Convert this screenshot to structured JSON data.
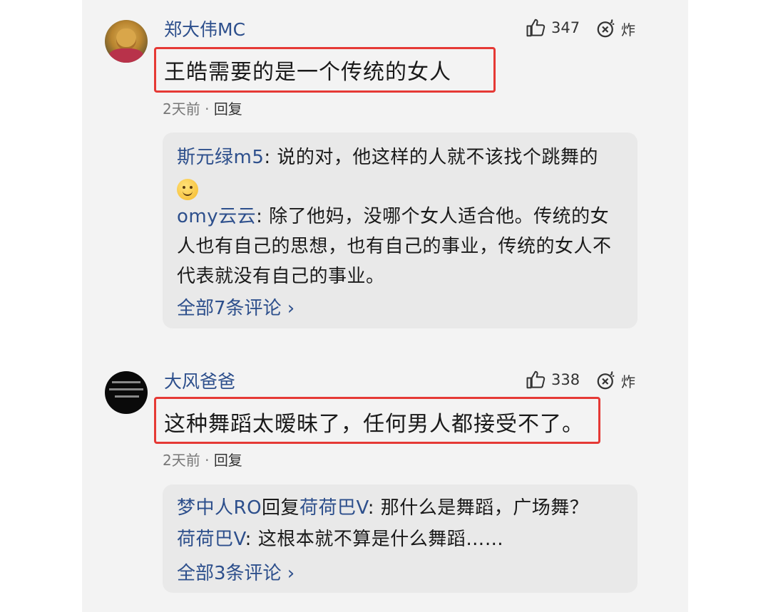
{
  "comments": [
    {
      "username": "郑大伟MC",
      "likes": "347",
      "bomb_label": "炸",
      "text": "王皓需要的是一个传统的女人",
      "time": "2天前",
      "separator": "·",
      "reply_label": "回复",
      "replies": [
        {
          "name": "斯元绿m5",
          "colon": ":",
          "text": " 说的对，他这样的人就不该找个跳舞的",
          "emoji": "smile-emoji"
        },
        {
          "name": "omy云云",
          "colon": ":",
          "text": " 除了他妈，没哪个女人适合他。传统的女人也有自己的思想，也有自己的事业，传统的女人不代表就没有自己的事业。"
        }
      ],
      "view_all": "全部7条评论 ›"
    },
    {
      "username": "大风爸爸",
      "likes": "338",
      "bomb_label": "炸",
      "text": "这种舞蹈太暧昧了，任何男人都接受不了。",
      "time": "2天前",
      "separator": "·",
      "reply_label": "回复",
      "replies": [
        {
          "name": "梦中人RO",
          "mid": "回复",
          "name2": "荷荷巴V",
          "colon": ":",
          "text": " 那什么是舞蹈，广场舞？"
        },
        {
          "name": "荷荷巴V",
          "colon": ":",
          "text": " 这根本就不算是什么舞蹈……"
        }
      ],
      "view_all": "全部3条评论 ›"
    }
  ],
  "colors": {
    "panel_bg": "#f3f3f3",
    "reply_bg": "#e9e9e9",
    "name_link": "#2d4f8c",
    "highlight": "#e53935"
  },
  "icons": {
    "like": "thumbs-up-icon",
    "bomb": "bomb-icon",
    "emoji": "smile-emoji"
  }
}
